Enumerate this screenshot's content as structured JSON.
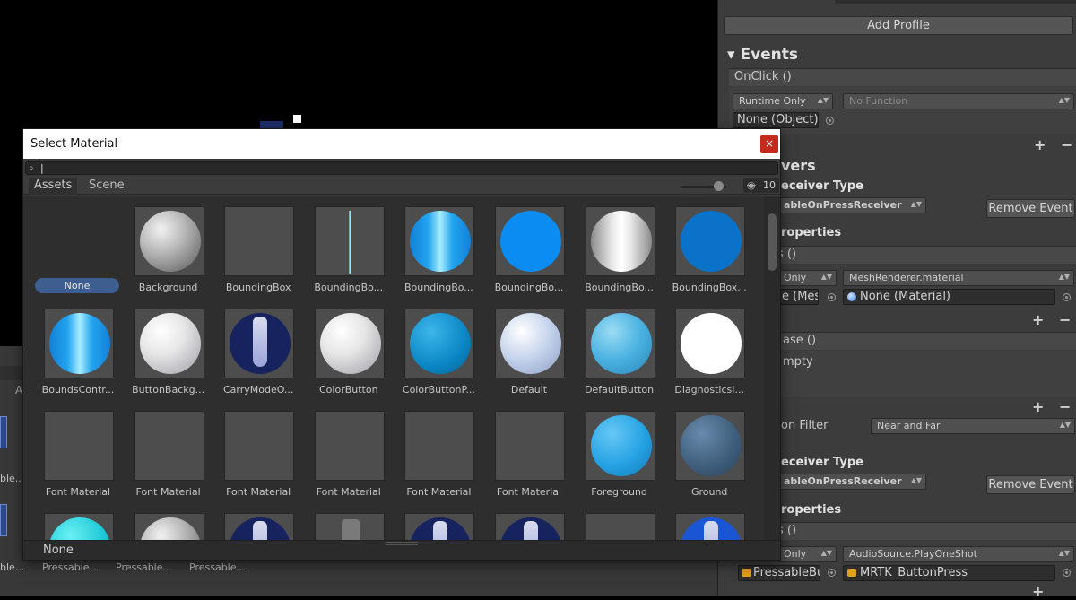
{
  "window": {
    "title": "Select Material",
    "close_glyph": "×",
    "search_value": "",
    "search_icon": "magnifier-icon"
  },
  "tabs": [
    "Assets",
    "Scene"
  ],
  "toolbar": {
    "hidden_count": "10"
  },
  "grid": {
    "none_label": "None",
    "items": [
      {
        "label": "Background",
        "type": "sphere",
        "style": "grey"
      },
      {
        "label": "BoundingBox",
        "type": "blank"
      },
      {
        "label": "BoundingBo...",
        "type": "line"
      },
      {
        "label": "BoundingBo...",
        "type": "sphere",
        "style": "blue-streak"
      },
      {
        "label": "BoundingBo...",
        "type": "sphere",
        "style": "flat-blue"
      },
      {
        "label": "BoundingBo...",
        "type": "sphere",
        "style": "white-streak"
      },
      {
        "label": "BoundingBox...",
        "type": "sphere",
        "style": "dark-blue"
      },
      {
        "label": "BoundsContr...",
        "type": "sphere",
        "style": "blue-streak"
      },
      {
        "label": "ButtonBackg...",
        "type": "sphere",
        "style": "white"
      },
      {
        "label": "CarryModeO...",
        "type": "sphere",
        "style": "navy-tie"
      },
      {
        "label": "ColorButton",
        "type": "sphere",
        "style": "white"
      },
      {
        "label": "ColorButtonP...",
        "type": "sphere",
        "style": "teal"
      },
      {
        "label": "Default",
        "type": "sphere",
        "style": "pale-blue"
      },
      {
        "label": "DefaultButton",
        "type": "sphere",
        "style": "light-blue"
      },
      {
        "label": "DiagnosticsI...",
        "type": "sphere",
        "style": "flat-white"
      },
      {
        "label": "Font Material",
        "type": "blank"
      },
      {
        "label": "Font Material",
        "type": "blank"
      },
      {
        "label": "Font Material",
        "type": "blank"
      },
      {
        "label": "Font Material",
        "type": "blank"
      },
      {
        "label": "Font Material",
        "type": "blank"
      },
      {
        "label": "Font Material",
        "type": "blank"
      },
      {
        "label": "Foreground",
        "type": "sphere",
        "style": "sky"
      },
      {
        "label": "Ground",
        "type": "sphere",
        "style": "slate"
      },
      {
        "label": "",
        "type": "sphere",
        "style": "cyan"
      },
      {
        "label": "",
        "type": "sphere",
        "style": "grey"
      },
      {
        "label": "",
        "type": "sphere",
        "style": "navy-tie"
      },
      {
        "label": "",
        "type": "sphere",
        "style": "grey-figure"
      },
      {
        "label": "",
        "type": "sphere",
        "style": "navy-tie"
      },
      {
        "label": "",
        "type": "sphere",
        "style": "navy-tie"
      },
      {
        "label": "",
        "type": "blank"
      },
      {
        "label": "",
        "type": "sphere",
        "style": "blue-tie"
      }
    ]
  },
  "status": {
    "selected": "None"
  },
  "background_panel": {
    "tab_letter": "A",
    "labels_row1": [
      "ble..."
    ],
    "labels_row2": [
      "ble...",
      "Pressable...",
      "Pressable...",
      "Pressable..."
    ]
  },
  "inspector": {
    "add_profile": "Add Profile",
    "events_header": "Events",
    "onclick": "OnClick ()",
    "runtime_only_1": "Runtime Only",
    "no_function": "No Function",
    "none_object": "None (Object)",
    "receivers_header": "vers",
    "receiver_type_1": "eceiver Type",
    "receiver_dd_1": "ableOnPressReceiver",
    "remove_event_1": "Remove Event",
    "properties_1": "roperties",
    "event_bar_1": "s ()",
    "only_1": "Only",
    "meshrenderer": "MeshRenderer.material",
    "target_field_1": "e (Mes",
    "none_material": "None (Material)",
    "release_bar": "ase ()",
    "empty_text": "mpty",
    "filter_label": "on Filter",
    "near_far": "Near and Far",
    "receiver_type_2": "eceiver Type",
    "receiver_dd_2": "ableOnPressReceiver",
    "remove_event_2": "Remove Event",
    "properties_2": "roperties",
    "event_bar_2": "s ()",
    "only_2": "Only",
    "audiosource": "AudioSource.PlayOneShot",
    "pressable_field": "PressableBu",
    "mrtk_field": "MRTK_ButtonPress",
    "plus": "+",
    "minus": "−"
  }
}
